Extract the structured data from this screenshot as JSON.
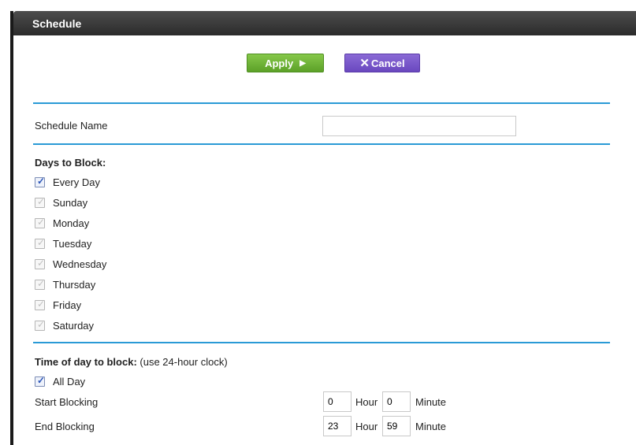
{
  "header": {
    "title": "Schedule"
  },
  "buttons": {
    "apply": "Apply",
    "cancel": "Cancel"
  },
  "schedule_name": {
    "label": "Schedule Name",
    "value": ""
  },
  "days": {
    "heading": "Days to Block:",
    "items": [
      {
        "label": "Every Day",
        "checked": true
      },
      {
        "label": "Sunday",
        "checked": false
      },
      {
        "label": "Monday",
        "checked": false
      },
      {
        "label": "Tuesday",
        "checked": false
      },
      {
        "label": "Wednesday",
        "checked": false
      },
      {
        "label": "Thursday",
        "checked": false
      },
      {
        "label": "Friday",
        "checked": false
      },
      {
        "label": "Saturday",
        "checked": false
      }
    ]
  },
  "time": {
    "heading": "Time of day to block:",
    "note": "(use 24-hour clock)",
    "all_day": {
      "label": "All Day",
      "checked": true
    },
    "start": {
      "label": "Start Blocking",
      "hour": "0",
      "minute": "0"
    },
    "end": {
      "label": "End Blocking",
      "hour": "23",
      "minute": "59"
    },
    "hour_label": "Hour",
    "minute_label": "Minute"
  }
}
